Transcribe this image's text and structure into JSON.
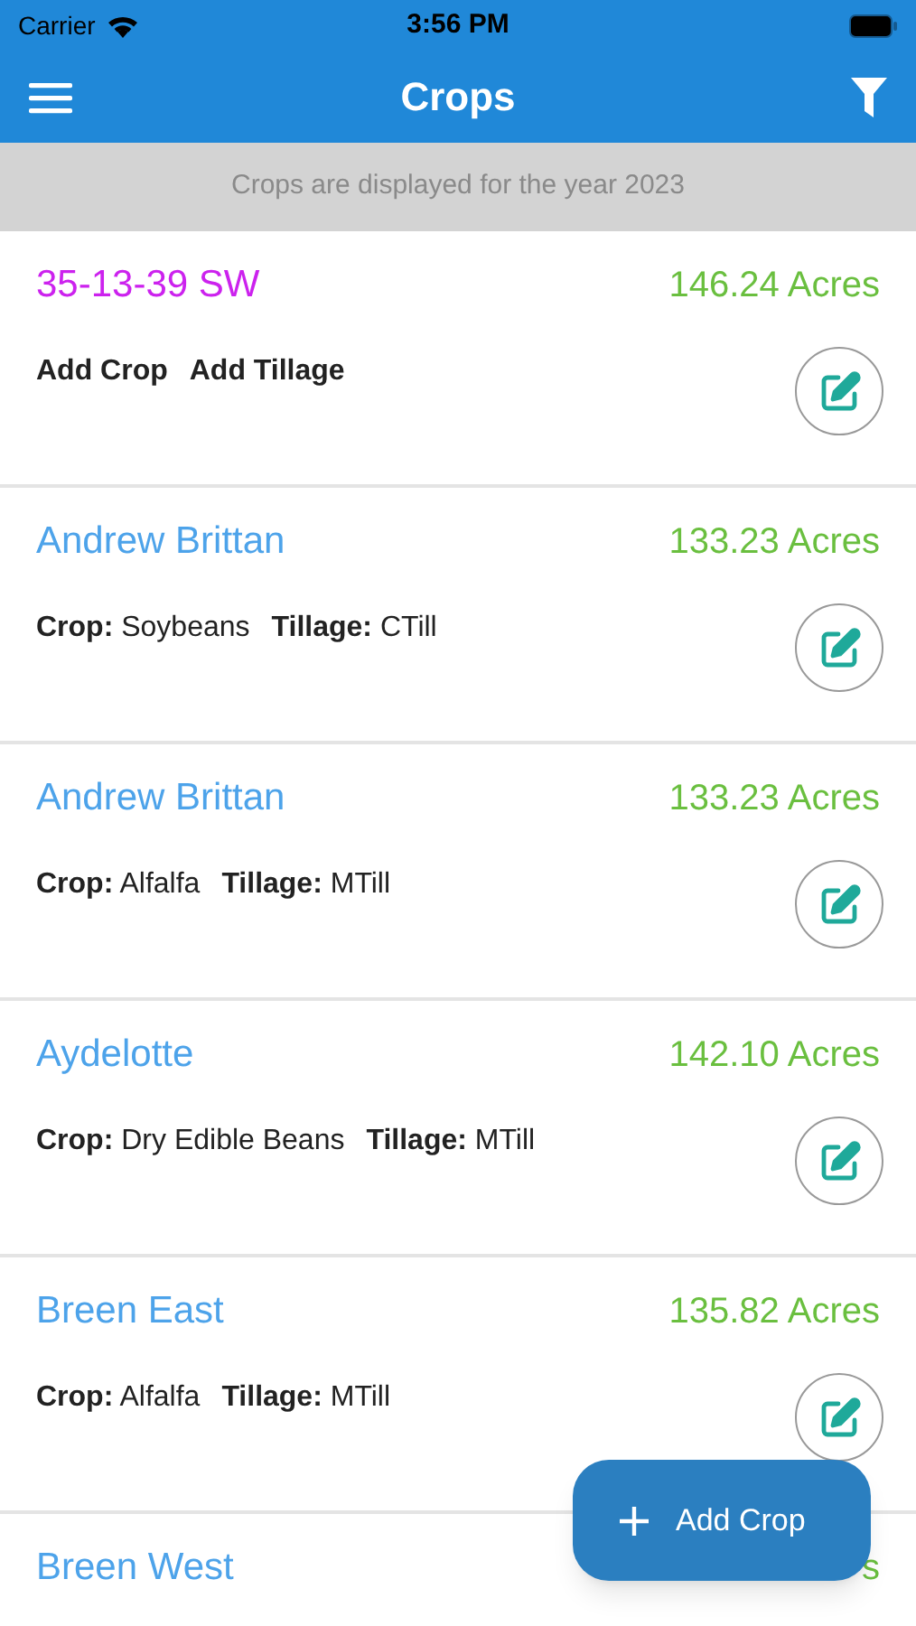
{
  "status_bar": {
    "carrier": "Carrier",
    "time": "3:56 PM"
  },
  "header": {
    "title": "Crops"
  },
  "banner": "Crops are displayed for the year 2023",
  "fields": [
    {
      "name": "35-13-39 SW",
      "color": "#cc22ee",
      "acres": "146.24 Acres",
      "details": [
        {
          "kind": "action",
          "text": "Add Crop"
        },
        {
          "kind": "action",
          "text": "Add Tillage"
        }
      ]
    },
    {
      "name": "Andrew Brittan",
      "color": "#4da3ea",
      "acres": "133.23 Acres",
      "details": [
        {
          "kind": "field",
          "label": "Crop:",
          "value": "Soybeans"
        },
        {
          "kind": "field",
          "label": "Tillage:",
          "value": "CTill"
        }
      ]
    },
    {
      "name": "Andrew Brittan",
      "color": "#4da3ea",
      "acres": "133.23 Acres",
      "details": [
        {
          "kind": "field",
          "label": "Crop:",
          "value": "Alfalfa"
        },
        {
          "kind": "field",
          "label": "Tillage:",
          "value": "MTill"
        }
      ]
    },
    {
      "name": "Aydelotte",
      "color": "#4da3ea",
      "acres": "142.10 Acres",
      "details": [
        {
          "kind": "field",
          "label": "Crop:",
          "value": "Dry Edible Beans"
        },
        {
          "kind": "field",
          "label": "Tillage:",
          "value": "MTill"
        }
      ]
    },
    {
      "name": "Breen East",
      "color": "#4da3ea",
      "acres": "135.82 Acres",
      "details": [
        {
          "kind": "field",
          "label": "Crop:",
          "value": "Alfalfa"
        },
        {
          "kind": "field",
          "label": "Tillage:",
          "value": "MTill"
        }
      ]
    },
    {
      "name": "Breen West",
      "color": "#4da3ea",
      "acres": "s"
    }
  ],
  "fab": {
    "label": "Add Crop"
  }
}
